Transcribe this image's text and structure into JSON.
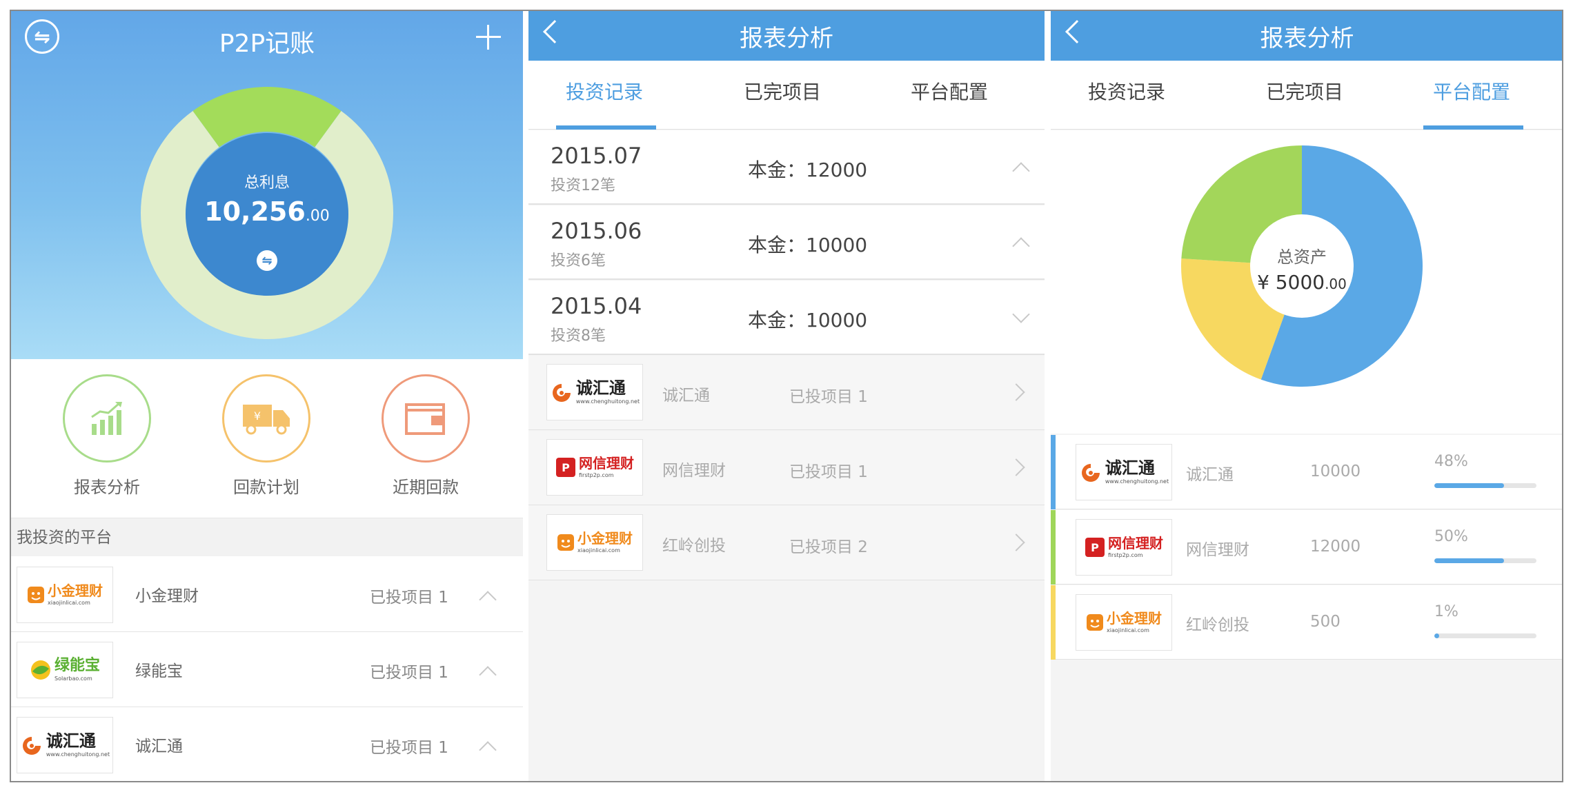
{
  "colors": {
    "primary": "#4e9ee0",
    "green": "#9fd65a",
    "yellow": "#f7d860",
    "blue": "#5aa8e6",
    "pale_green": "#e2efcf"
  },
  "screen1": {
    "title": "P2P记账",
    "donut": {
      "label": "总利息",
      "value_main": "10,256",
      "value_decimal": ".00",
      "segments": [
        {
          "name": "green",
          "fraction": 0.2,
          "color": "#a3dc5a"
        },
        {
          "name": "rest",
          "fraction": 0.8,
          "color": "#e1eecb"
        }
      ]
    },
    "shortcuts": [
      {
        "label": "报表分析",
        "icon": "bar-chart-icon",
        "color": "#a8dc8a"
      },
      {
        "label": "回款计划",
        "icon": "delivery-truck-icon",
        "color": "#f5c26b"
      },
      {
        "label": "近期回款",
        "icon": "wallet-icon",
        "color": "#ef9a7a"
      }
    ],
    "section_title": "我投资的平台",
    "platforms": [
      {
        "logo_text": "小金理财",
        "logo_url": "xiaojinlicai.com",
        "name": "小金理财",
        "count": "已投项目  1"
      },
      {
        "logo_text": "绿能宝",
        "logo_url": "Solarbao.com",
        "name": "绿能宝",
        "count": "已投项目  1"
      },
      {
        "logo_text": "诚汇通",
        "logo_url": "www.chenghuitong.net",
        "name": "诚汇通",
        "count": "已投项目  1"
      }
    ]
  },
  "screen2": {
    "title": "报表分析",
    "tabs": [
      "投资记录",
      "已完项目",
      "平台配置"
    ],
    "months": [
      {
        "date": "2015.07",
        "sub": "投资12笔",
        "amount": "本金：12000",
        "expanded": true
      },
      {
        "date": "2015.06",
        "sub": "投资6笔",
        "amount": "本金：10000",
        "expanded": true
      },
      {
        "date": "2015.04",
        "sub": "投资8笔",
        "amount": "本金：10000",
        "expanded": false
      }
    ],
    "platforms": [
      {
        "logo_text": "诚汇通",
        "logo_url": "www.chenghuitong.net",
        "name": "诚汇通",
        "count": "已投项目  1"
      },
      {
        "logo_text": "网信理财",
        "logo_url": "firstp2p.com",
        "name": "网信理财",
        "count": "已投项目  1"
      },
      {
        "logo_text": "小金理财",
        "logo_url": "xiaojinlicai.com",
        "name": "红岭创投",
        "count": "已投项目  2"
      }
    ]
  },
  "screen3": {
    "title": "报表分析",
    "tabs": [
      "投资记录",
      "已完项目",
      "平台配置"
    ],
    "donut": {
      "label": "总资产",
      "value_main": "¥ 5000",
      "value_decimal": ".00",
      "segments": [
        {
          "name": "blue",
          "fraction": 0.555,
          "color": "#5aa8e6"
        },
        {
          "name": "yellow",
          "fraction": 0.205,
          "color": "#f7d860"
        },
        {
          "name": "green",
          "fraction": 0.24,
          "color": "#a3d65a"
        }
      ]
    },
    "allocations": [
      {
        "logo_text": "诚汇通",
        "logo_url": "www.chenghuitong.net",
        "name": "诚汇通",
        "amount": "10000",
        "percent": "48%",
        "fraction": 0.68,
        "accent": "#5aa8e6"
      },
      {
        "logo_text": "网信理财",
        "logo_url": "firstp2p.com",
        "name": "网信理财",
        "amount": "12000",
        "percent": "50%",
        "fraction": 0.68,
        "accent": "#9fd65a"
      },
      {
        "logo_text": "小金理财",
        "logo_url": "xiaojinlicai.com",
        "name": "红岭创投",
        "amount": "500",
        "percent": "1%",
        "fraction": 0.05,
        "accent": "#f7d860"
      }
    ]
  }
}
